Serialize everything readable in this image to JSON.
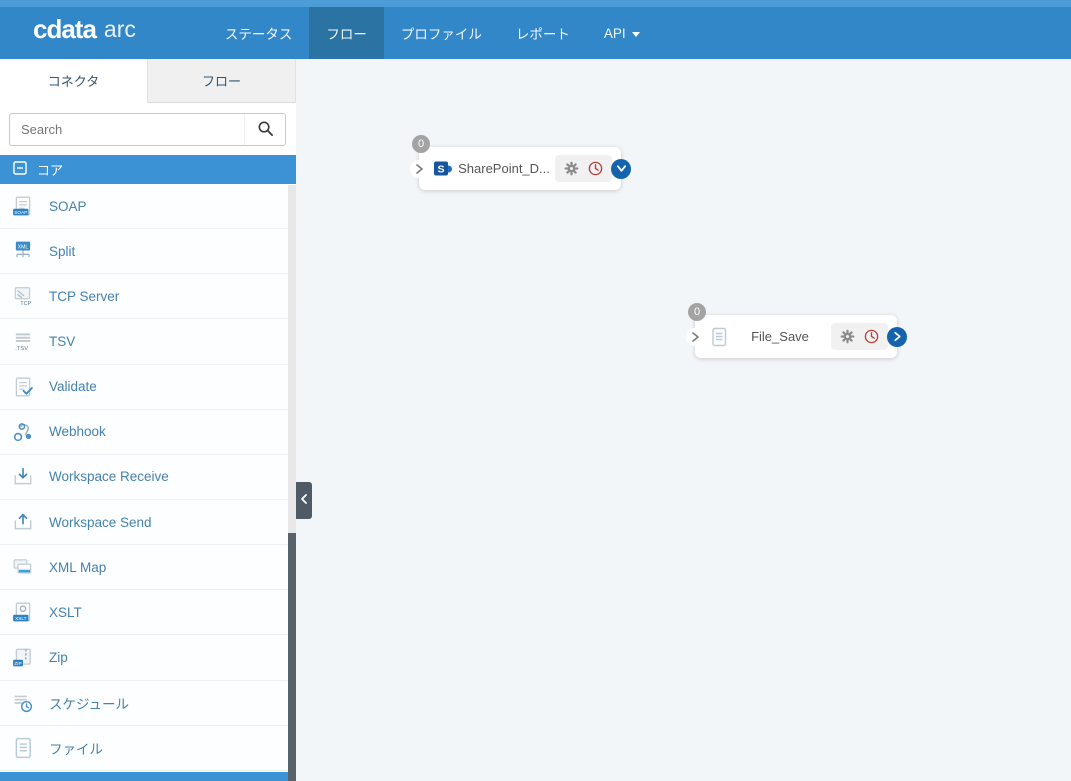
{
  "nav": {
    "logo": {
      "brand": "cdata",
      "product": "arc"
    },
    "items": [
      {
        "label": "ステータス",
        "active": false,
        "has_caret": false
      },
      {
        "label": "フロー",
        "active": true,
        "has_caret": false
      },
      {
        "label": "プロファイル",
        "active": false,
        "has_caret": false
      },
      {
        "label": "レポート",
        "active": false,
        "has_caret": false
      },
      {
        "label": "API",
        "active": false,
        "has_caret": true
      }
    ]
  },
  "sidebar": {
    "tabs": [
      {
        "label": "コネクタ",
        "active": true
      },
      {
        "label": "フロー",
        "active": false
      }
    ],
    "search": {
      "placeholder": "Search",
      "value": "",
      "icon": "search-icon"
    },
    "section": {
      "label": "コア",
      "icon": "minus-square-icon"
    },
    "items": [
      {
        "label": "SOAP",
        "icon": "soap-document-icon"
      },
      {
        "label": "Split",
        "icon": "split-icon"
      },
      {
        "label": "TCP Server",
        "icon": "tcp-server-icon"
      },
      {
        "label": "TSV",
        "icon": "tsv-document-icon"
      },
      {
        "label": "Validate",
        "icon": "validate-document-icon"
      },
      {
        "label": "Webhook",
        "icon": "webhook-icon"
      },
      {
        "label": "Workspace Receive",
        "icon": "workspace-receive-icon"
      },
      {
        "label": "Workspace Send",
        "icon": "workspace-send-icon"
      },
      {
        "label": "XML Map",
        "icon": "xml-map-icon"
      },
      {
        "label": "XSLT",
        "icon": "xslt-document-icon"
      },
      {
        "label": "Zip",
        "icon": "zip-icon"
      },
      {
        "label": "スケジュール",
        "icon": "schedule-icon"
      },
      {
        "label": "ファイル",
        "icon": "file-document-icon"
      }
    ]
  },
  "canvas": {
    "collapse_handle_icon": "chevron-left-icon",
    "nodes": [
      {
        "name": "SharePoint_D...",
        "badge": "0",
        "icon": "sharepoint-icon",
        "actions": [
          "settings-gear-icon",
          "schedule-clock-icon"
        ],
        "expand_icon": "chevron-down-circle-icon"
      },
      {
        "name": "File_Save",
        "badge": "0",
        "icon": "file-document-icon",
        "actions": [
          "settings-gear-icon",
          "schedule-clock-icon"
        ],
        "expand_icon": "chevron-right-circle-icon"
      }
    ]
  },
  "colors": {
    "nav_blue": "#3287c9",
    "nav_active_blue": "#2b73a3",
    "section_header_blue": "#3b92d4",
    "link_blue": "#4581ad",
    "node_expand_blue": "#1563ae",
    "clock_red": "#b5413f",
    "gear_gray": "#8b8b8b",
    "badge_gray": "#a3a3a3",
    "scroll_thumb": "#59616b",
    "canvas_bg": "#f3f6f9"
  }
}
